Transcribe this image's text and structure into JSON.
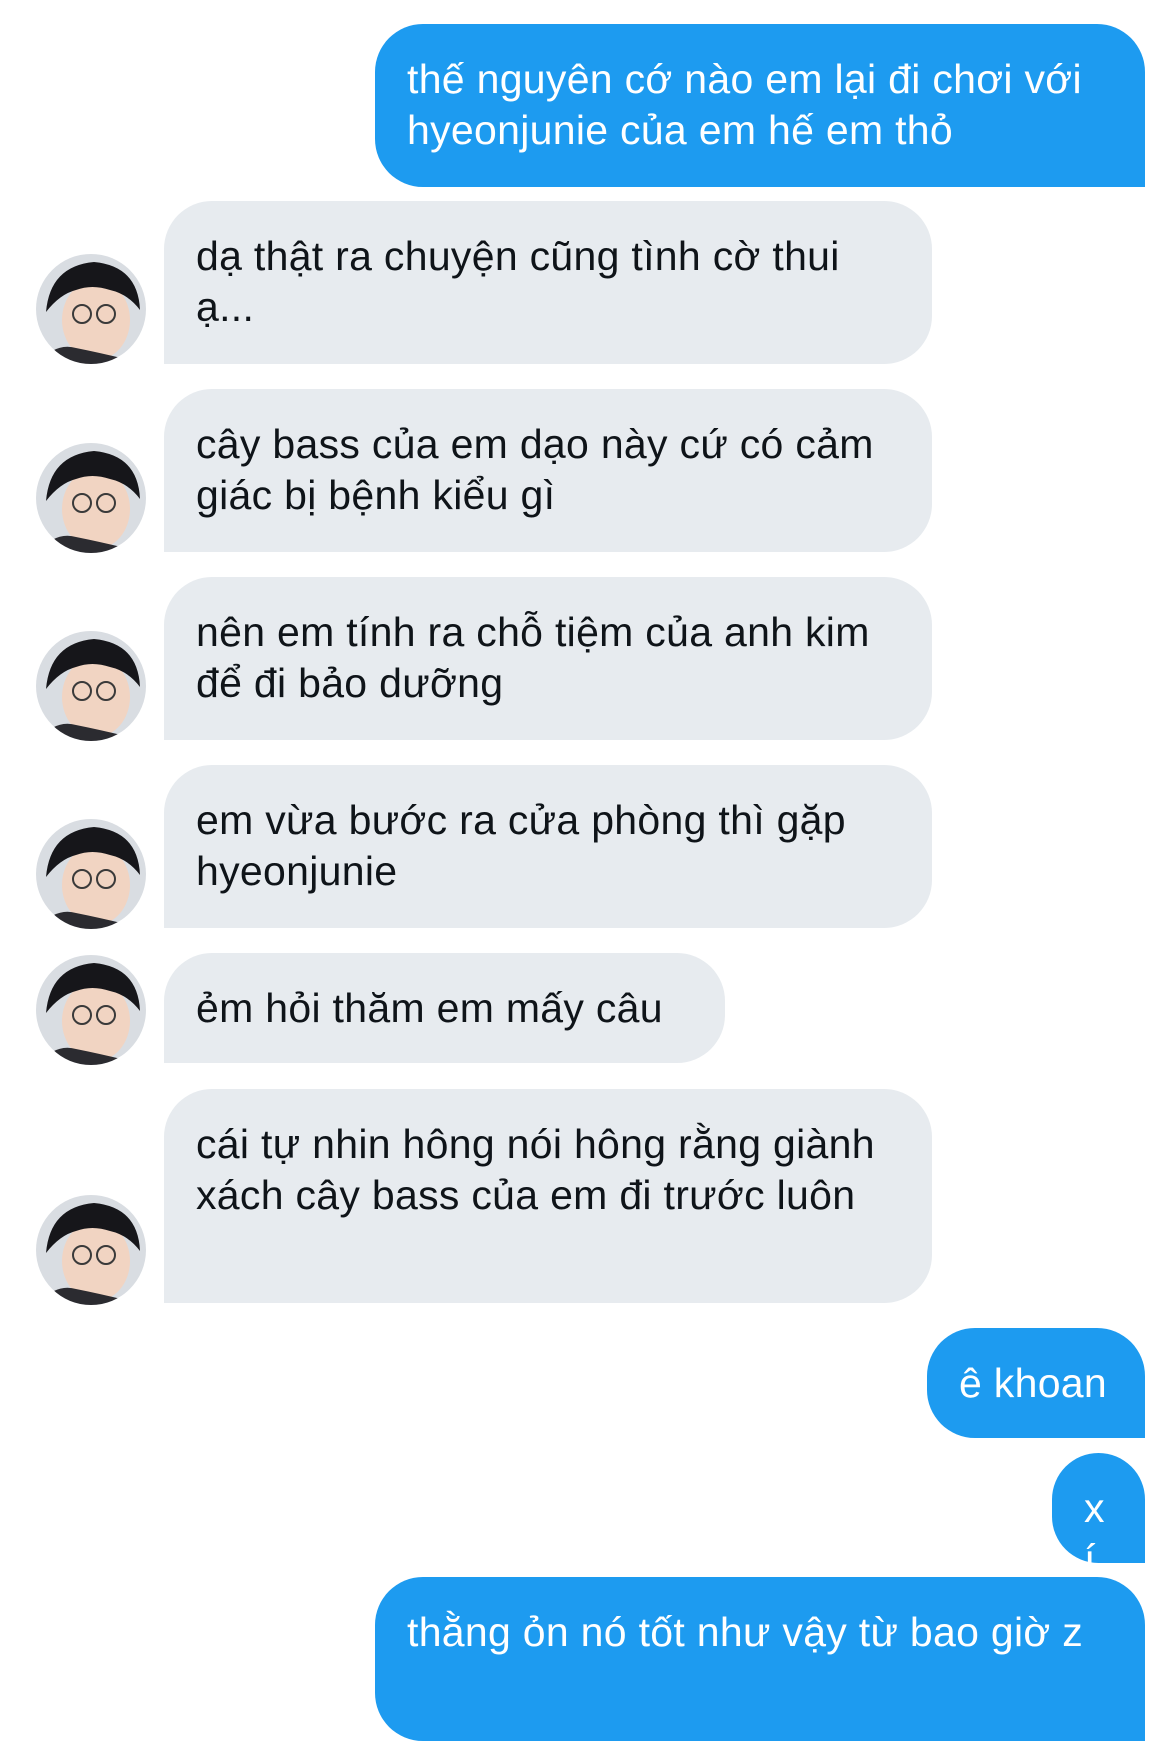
{
  "messages": [
    {
      "side": "sent",
      "text": "thế nguyên cớ nào em lại đi chơi với hyeonjunie của em hế em thỏ"
    },
    {
      "side": "received",
      "text": "dạ thật ra chuyện cũng tình cờ thui ạ..."
    },
    {
      "side": "received",
      "text": "cây bass của em dạo này cứ có cảm giác bị bệnh kiểu gì"
    },
    {
      "side": "received",
      "text": "nên em tính ra chỗ tiệm của anh kim để đi bảo dưỡng"
    },
    {
      "side": "received",
      "text": "em vừa bước ra cửa phòng thì gặp hyeonjunie"
    },
    {
      "side": "received",
      "text": "ẻm hỏi thăm em mấy câu"
    },
    {
      "side": "received",
      "text": "cái tự nhin hông nói hông rằng giành xách cây bass của em đi trước luôn"
    },
    {
      "side": "sent",
      "text": "ê khoan"
    },
    {
      "side": "sent",
      "text": "xí"
    },
    {
      "side": "sent",
      "text": "thằng ỏn nó tốt như vậy từ bao giờ z"
    }
  ],
  "contact": {
    "avatar_icon": "profile-photo-avatar"
  },
  "colors": {
    "sent_bubble": "#1d9bf0",
    "received_bubble": "#e7ebef",
    "sent_text": "#ffffff",
    "received_text": "#0f1419"
  }
}
